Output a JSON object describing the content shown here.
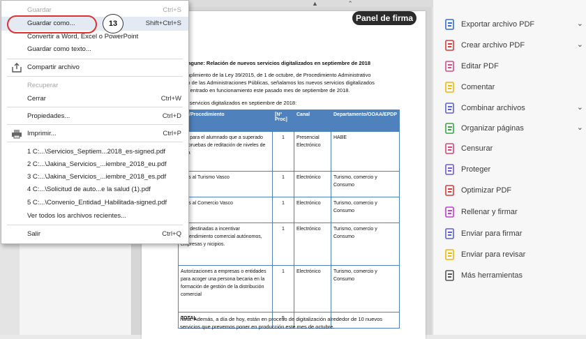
{
  "file_menu": {
    "items": [
      {
        "label": "Guardar",
        "shortcut": "Ctrl+S",
        "disabled": true
      },
      {
        "label": "Guardar como...",
        "shortcut": "Shift+Ctrl+S",
        "highlighted": true
      },
      {
        "label": "Convertir a Word, Excel o PowerPoint",
        "shortcut": ""
      },
      {
        "label": "Guardar como texto...",
        "shortcut": ""
      },
      {
        "label": "Compartir archivo",
        "shortcut": ""
      },
      {
        "label": "Recuperar",
        "shortcut": "",
        "disabled": true
      },
      {
        "label": "Cerrar",
        "shortcut": "Ctrl+W"
      },
      {
        "label": "Propiedades...",
        "shortcut": "Ctrl+D"
      },
      {
        "label": "Imprimir...",
        "shortcut": "Ctrl+P"
      }
    ],
    "recent_files": [
      "1 C:...\\Servicios_Septiem...2018_es-signed.pdf",
      "2 C:...\\Jakina_Servicios_...iembre_2018_eu.pdf",
      "3 C:...\\Jakina_Servicios_...iembre_2018_es.pdf",
      "4 C:...\\Solicitud de auto...e la salud (1).pdf",
      "5 C:...\\Convenio_Entidad_Habilitada-signed.pdf"
    ],
    "view_all": "Ver todos los archivos recientes...",
    "exit": {
      "label": "Salir",
      "shortcut": "Ctrl+Q"
    }
  },
  "annotation": {
    "step": "13"
  },
  "document": {
    "signature_panel_button": "Panel de firma",
    "heading": "mitagune: Relación de nuevos servicios digitalizados en septiembre de 2018",
    "para_lines": [
      "cumplimiento de la Ley 39/2015, de 1 de octubre, de Procedimiento Administrativo",
      "mún de las Administraciones Públicas, señalamos los nuevos servicios digitalizados",
      "han entrado en funcionamiento este pasado mes de septiembre de 2018."
    ],
    "intro": "vos servicios digitalizados en septiembre de 2018:",
    "table": {
      "headers": [
        "icio/Procedimiento",
        "[Nº Proc]",
        "Canal",
        "Departamento/OOAA/EPDP"
      ],
      "rows": [
        [
          "das para el alumnado que a superado las pruebas de reditación de niveles de sera",
          "1",
          "Presencial Electrónico",
          "HABE"
        ],
        [
          "mios al Turismo Vasco",
          "1",
          "Electrónico",
          "Turismo, comercio y Consumo"
        ],
        [
          "mios al Comercio Vasco",
          "1",
          "Electrónico",
          "Turismo, comercio y Consumo"
        ],
        [
          "das destinadas a incentivar mprendimiento comercial autónomos, empresas y nicipios.",
          "1",
          "Electrónico",
          "Turismo, comercio y Consumo"
        ],
        [
          "Autorizaciones a empresas o entidades para acoger una persona becaria en la formación de gestión de la distribución comercial",
          "1",
          "Electrónico",
          "Turismo, comercio y Consumo"
        ],
        [
          "TOTAL",
          "5",
          "",
          ""
        ]
      ]
    },
    "note": "Nota: Además, a día de hoy, están en proceso de digitalización alrededor de 10 nuevos servicios que prevemos poner en producción este mes de octubre."
  },
  "tools": [
    {
      "label": "Exportar archivo PDF",
      "icon": "export-pdf-icon",
      "color": "#2f6fd6",
      "chevron": true
    },
    {
      "label": "Crear archivo PDF",
      "icon": "create-pdf-icon",
      "color": "#d83b3b",
      "chevron": true
    },
    {
      "label": "Editar PDF",
      "icon": "edit-pdf-icon",
      "color": "#d64a8a",
      "chevron": false
    },
    {
      "label": "Comentar",
      "icon": "comment-icon",
      "color": "#f2b705",
      "chevron": false
    },
    {
      "label": "Combinar archivos",
      "icon": "combine-files-icon",
      "color": "#5b5fd6",
      "chevron": true
    },
    {
      "label": "Organizar páginas",
      "icon": "organize-pages-icon",
      "color": "#3aa34a",
      "chevron": true
    },
    {
      "label": "Censurar",
      "icon": "redact-icon",
      "color": "#d6447a",
      "chevron": false
    },
    {
      "label": "Proteger",
      "icon": "protect-icon",
      "color": "#6b5bd6",
      "chevron": false
    },
    {
      "label": "Optimizar PDF",
      "icon": "optimize-pdf-icon",
      "color": "#d83b3b",
      "chevron": false
    },
    {
      "label": "Rellenar y firmar",
      "icon": "fill-sign-icon",
      "color": "#c23bd6",
      "chevron": false
    },
    {
      "label": "Enviar para firmar",
      "icon": "send-sign-icon",
      "color": "#5b5fd6",
      "chevron": false
    },
    {
      "label": "Enviar para revisar",
      "icon": "send-review-icon",
      "color": "#f2b705",
      "chevron": false
    },
    {
      "label": "Más herramientas",
      "icon": "more-tools-icon",
      "color": "#555555",
      "chevron": false
    }
  ]
}
